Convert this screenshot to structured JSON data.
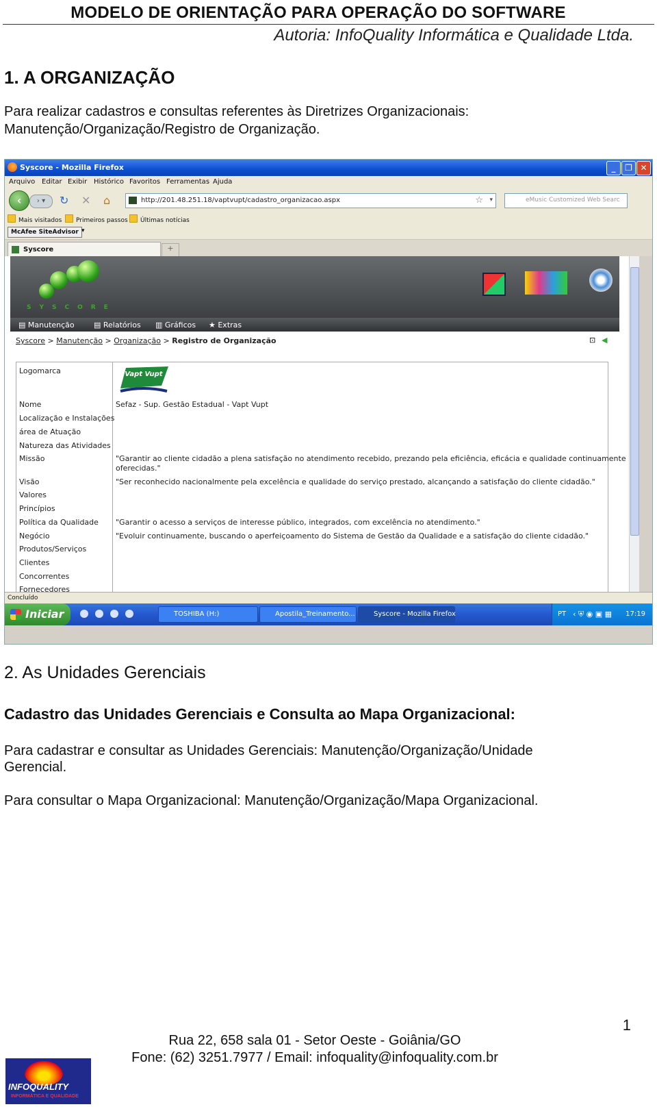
{
  "header": {
    "title": "MODELO DE ORIENTAÇÃO PARA OPERAÇÃO DO SOFTWARE",
    "author": "Autoria: InfoQuality Informática e Qualidade Ltda."
  },
  "section1": {
    "heading": "1. A ORGANIZAÇÃO",
    "line1": "Para realizar cadastros e consultas referentes às Diretrizes Organizacionais:",
    "line2": "Manutenção/Organização/Registro de Organização."
  },
  "screenshot": {
    "window_title": "Syscore - Mozilla Firefox",
    "menu": [
      "Arquivo",
      "Editar",
      "Exibir",
      "Histórico",
      "Favoritos",
      "Ferramentas",
      "Ajuda"
    ],
    "url": "http://201.48.251.18/vaptvupt/cadastro_organizacao.aspx",
    "search_placeholder": "eMusic Customized Web Searc",
    "bookmarks": [
      "Mais visitados",
      "Primeiros passos",
      "Últimas notícias"
    ],
    "mcafee": "McAfee SiteAdvisor",
    "tab_label": "Syscore",
    "syscore_word": "SYSCORE",
    "nav": [
      "Manutenção",
      "Relatórios",
      "Gráficos",
      "Extras"
    ],
    "breadcrumb": {
      "items": [
        "Syscore",
        "Manutenção",
        "Organização"
      ],
      "current": "Registro de Organização"
    },
    "vapt_logo": "Vapt Vupt",
    "fields": [
      "Logomarca",
      "Nome",
      "Localização e Instalações",
      "área de Atuação",
      "Natureza das Atividades",
      "Missão",
      "Visão",
      "Valores",
      "Princípios",
      "Política da Qualidade",
      "Negócio",
      "Produtos/Serviços",
      "Clientes",
      "Concorrentes",
      "Fornecedores"
    ],
    "values": {
      "nome": "Sefaz - Sup. Gestão Estadual - Vapt Vupt",
      "missao_1": "\"Garantir ao cliente cidadão a plena satisfação no atendimento recebido, prezando pela eficiência, eficácia e qualidade continuamente",
      "missao_2": "oferecidas.\"",
      "visao": "\"Ser reconhecido nacionalmente pela excelência e qualidade do serviço prestado, alcançando a satisfação do cliente cidadão.\"",
      "politica": "\"Garantir o acesso a serviços de interesse público, integrados, com excelência no atendimento.\"",
      "negocio": "\"Evoluir continuamente, buscando o aperfeiçoamento do Sistema de Gestão da Qualidade e a satisfação do cliente cidadão.\""
    },
    "status": "Concluído",
    "taskbar": {
      "start": "Iniciar",
      "buttons": [
        "TOSHIBA (H:)",
        "Apostila_Treinamento...",
        "Syscore - Mozilla Firefox"
      ],
      "lang": "PT",
      "clock": "17:19"
    }
  },
  "section2": {
    "heading": "2. As Unidades Gerenciais",
    "subheading": "Cadastro das Unidades Gerenciais e Consulta ao Mapa Organizacional:",
    "para1_l1": "Para cadastrar e consultar as Unidades Gerenciais: Manutenção/Organização/Unidade",
    "para1_l2": "Gerencial.",
    "para2": "Para consultar o Mapa Organizacional: Manutenção/Organização/Mapa Organizacional."
  },
  "footer": {
    "logo_brand": "INFOQUALITY",
    "logo_sub": "INFORMÁTICA E QUALIDADE",
    "address": "Rua 22, 658 sala 01 - Setor Oeste - Goiânia/GO",
    "contact": "Fone: (62) 3251.7977 / Email: infoquality@infoquality.com.br",
    "page": "1"
  }
}
